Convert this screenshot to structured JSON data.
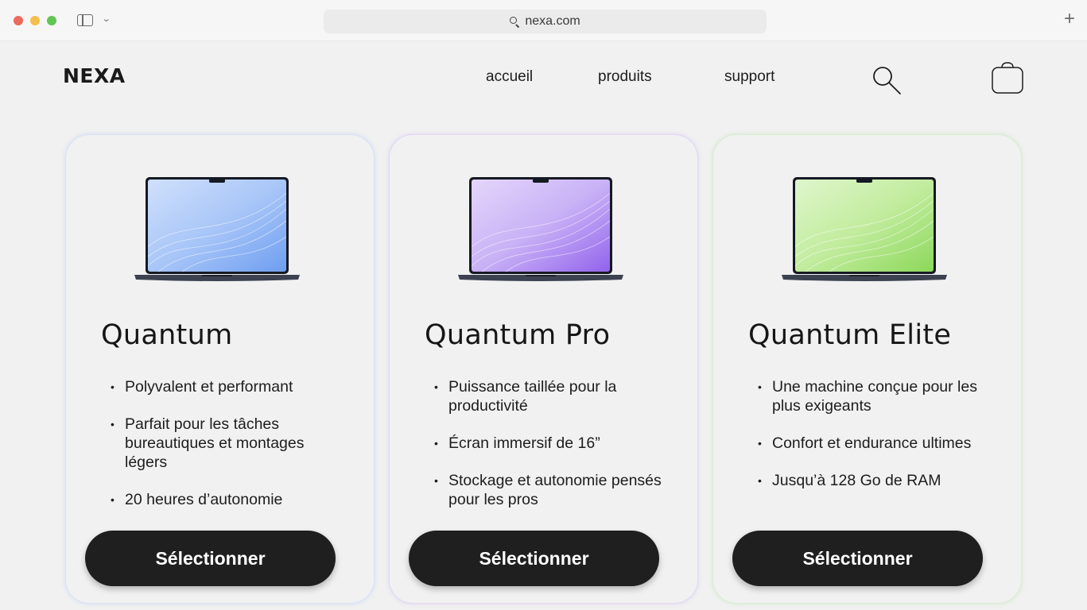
{
  "browser": {
    "url": "nexa.com"
  },
  "header": {
    "logo": "NEXA",
    "nav": [
      "accueil",
      "produits",
      "support"
    ]
  },
  "products": [
    {
      "name": "Quantum",
      "features": [
        "Polyvalent et performant",
        "Parfait pour les tâches bureautiques et montages légers",
        "20 heures d’autonomie"
      ],
      "button": "Sélectionner",
      "screen_colors": [
        "#a9c6f8",
        "#6e9ef0"
      ]
    },
    {
      "name": "Quantum Pro",
      "features": [
        "Puissance taillée pour la productivité",
        "Écran immersif de 16”",
        "Stockage et autonomie pensés pour les pros"
      ],
      "button": "Sélectionner",
      "screen_colors": [
        "#c9b2f6",
        "#9263ec"
      ]
    },
    {
      "name": "Quantum Elite",
      "features": [
        "Une machine conçue pour les plus exigeants",
        "Confort et endurance ultimes",
        "Jusqu’à 128 Go de RAM"
      ],
      "button": "Sélectionner",
      "screen_colors": [
        "#c2ec9e",
        "#8cd85a"
      ]
    }
  ]
}
